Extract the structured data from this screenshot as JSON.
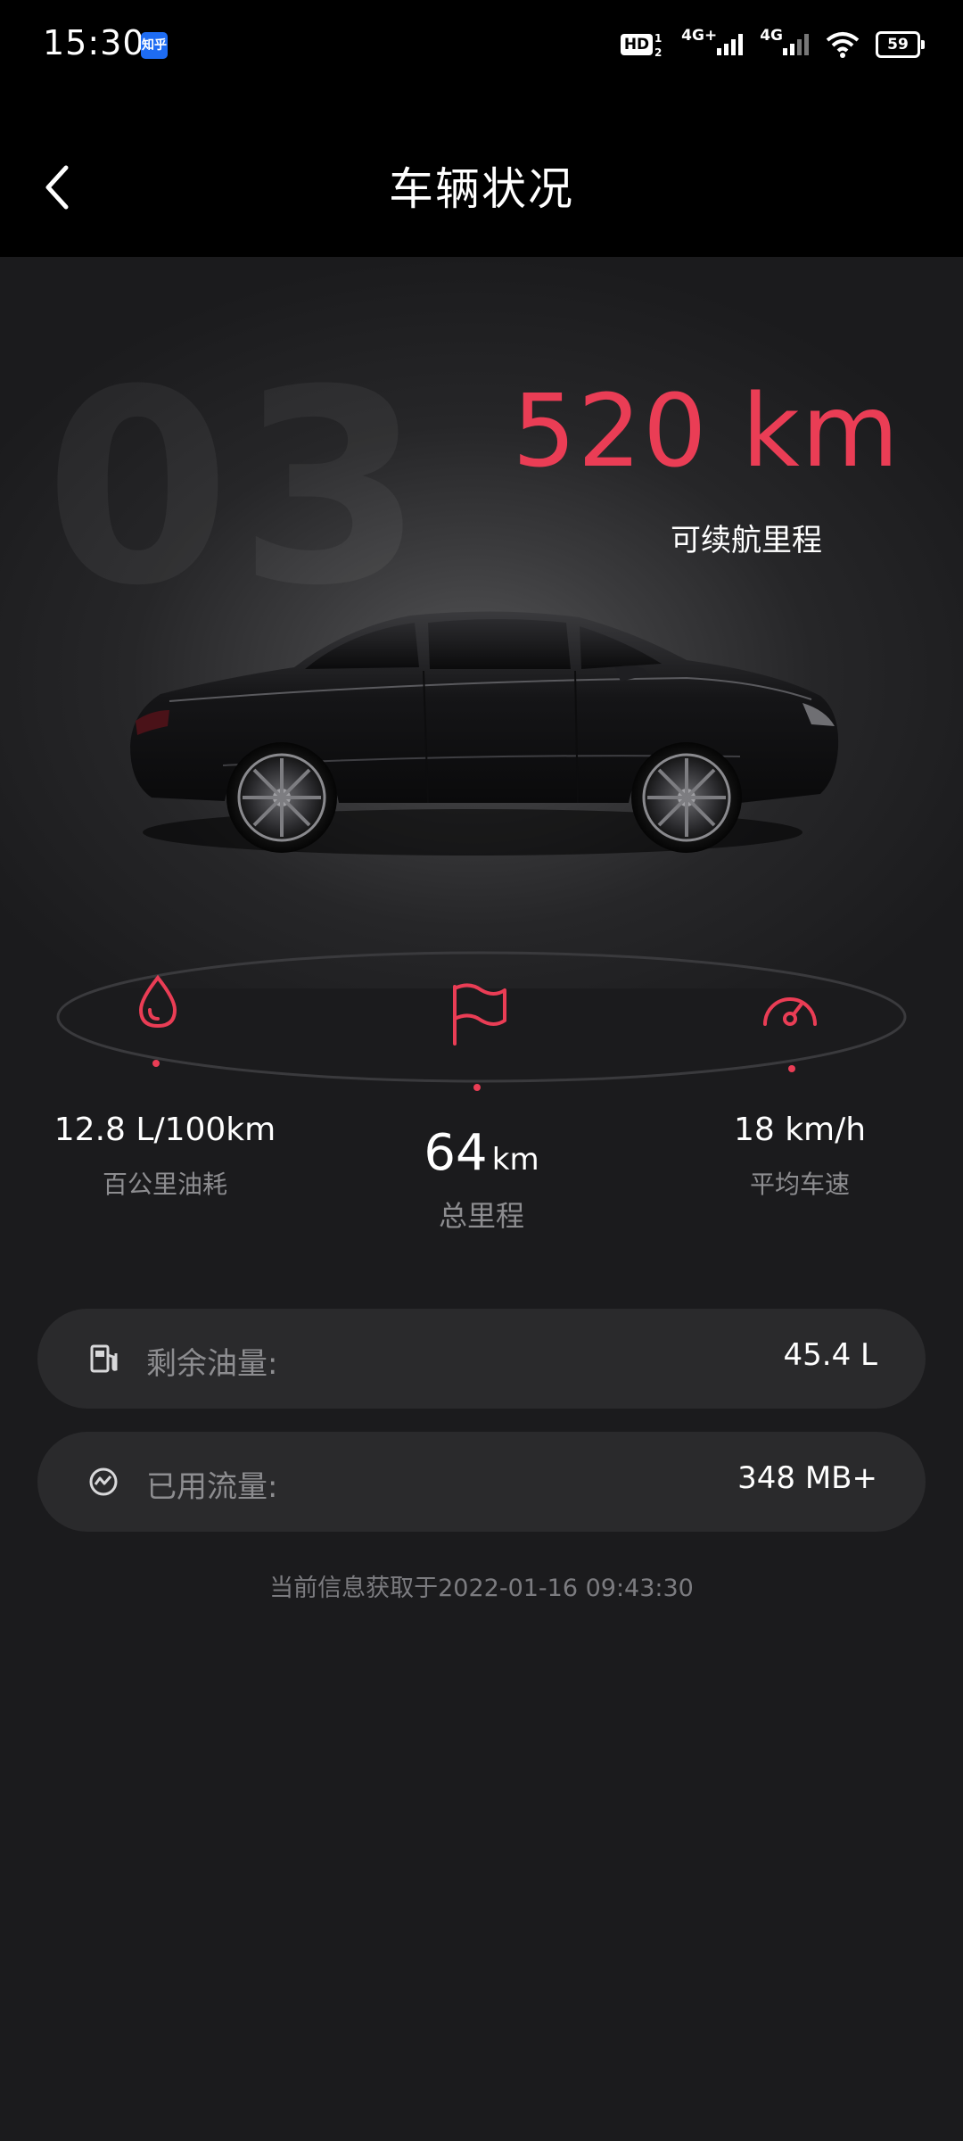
{
  "status_bar": {
    "time": "15:30",
    "app_badge": "知乎",
    "hd_label": "HD",
    "sim_index": "1 2",
    "network1": "4G+",
    "network2": "4G",
    "battery": "59"
  },
  "header": {
    "title": "车辆状况"
  },
  "hero": {
    "model_watermark": "03",
    "range_value": "520 km",
    "range_label": "可续航里程"
  },
  "stats": {
    "fuel_consumption": {
      "value": "12.8 L/100km",
      "label": "百公里油耗",
      "icon": "drop-icon"
    },
    "total_mileage": {
      "value": "64",
      "unit": "km",
      "label": "总里程",
      "icon": "flag-icon"
    },
    "avg_speed": {
      "value": "18 km/h",
      "label": "平均车速",
      "icon": "speedometer-icon"
    }
  },
  "info": {
    "fuel_remaining": {
      "label": "剩余油量:",
      "value": "45.4 L",
      "icon": "fuel-pump-icon"
    },
    "data_usage": {
      "label": "已用流量:",
      "value": "348 MB+",
      "icon": "data-usage-icon"
    }
  },
  "timestamp": "当前信息获取于2022-01-16 09:43:30",
  "colors": {
    "accent": "#ea3d55",
    "background": "#1b1b1d",
    "pill": "#2a2a2c",
    "muted_text": "#8d8d90"
  }
}
